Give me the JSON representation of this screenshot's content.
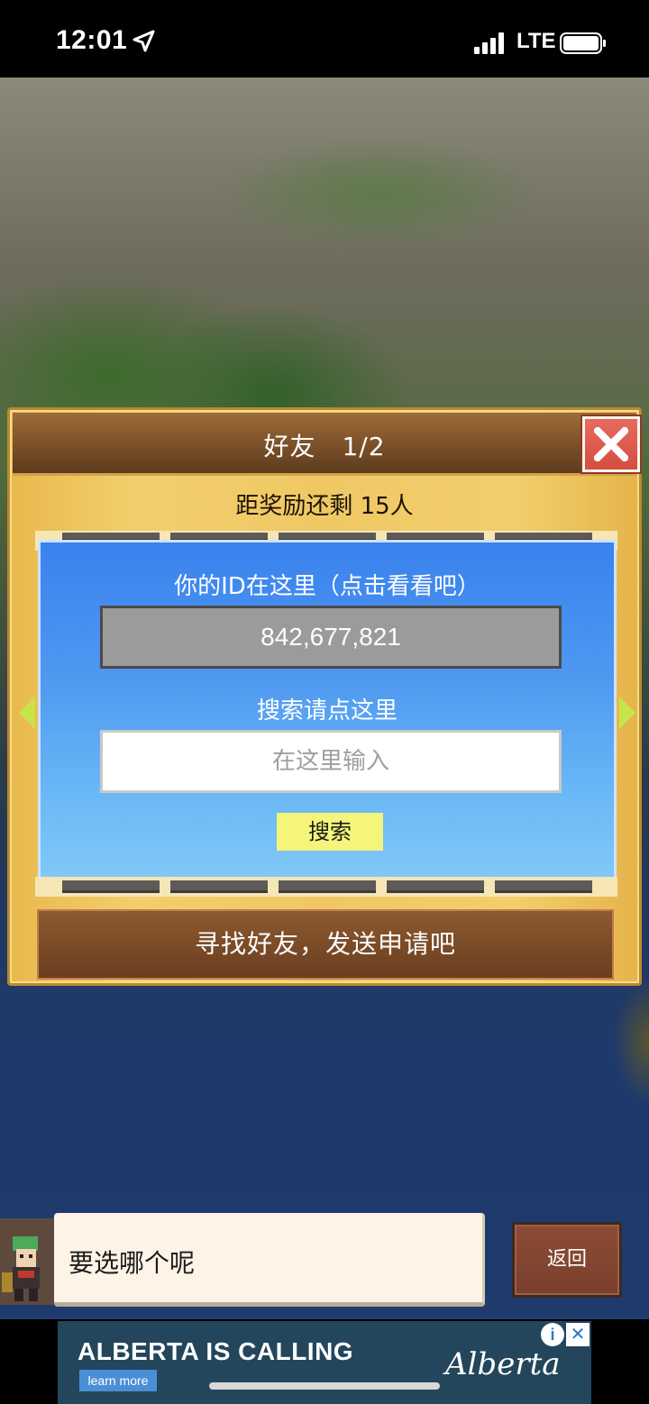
{
  "status_bar": {
    "time": "12:01",
    "network": "LTE",
    "icons": [
      "location-arrow-icon",
      "signal-bars-icon",
      "battery-icon"
    ]
  },
  "friends_panel": {
    "title": "好友　1/2",
    "reward_text": "距奖励还剩 15人",
    "id_label": "你的ID在这里（点击看看吧）",
    "user_id": "842,677,821",
    "search_label": "搜索请点这里",
    "search_placeholder": "在这里输入",
    "search_button": "搜索",
    "find_friends_button": "寻找好友，发送申请吧"
  },
  "dialogue": {
    "speech_text": "要选哪个呢",
    "back_button": "返回"
  },
  "ad": {
    "headline": "ALBERTA IS CALLING",
    "learn_more": "learn more",
    "brand": "Alberta",
    "info_icon_text": "i",
    "close_icon_text": "✕"
  },
  "colors": {
    "panel_gold": "#efc864",
    "header_brown": "#7e522a",
    "card_blue": "#4f98f0",
    "search_button_yellow": "#f4f57a",
    "close_red": "#d44d41"
  }
}
